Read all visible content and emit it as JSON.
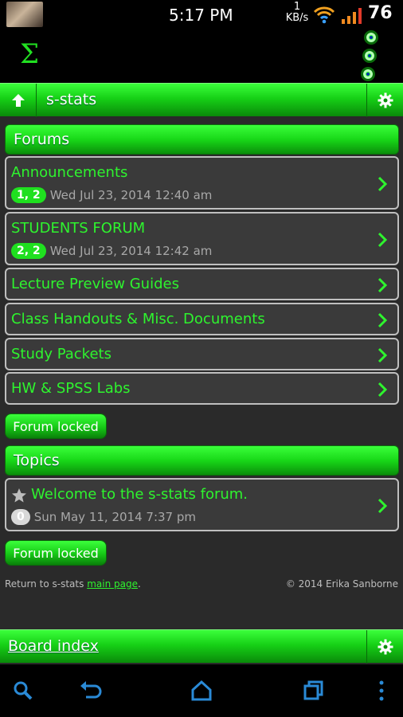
{
  "status_bar": {
    "time": "5:17 PM",
    "net_rate_value": "1",
    "net_rate_unit": "KB/s",
    "battery": "76"
  },
  "app": {
    "logo_symbol": "Σ",
    "accent_color": "#21e021"
  },
  "breadcrumb": {
    "title": "s-stats"
  },
  "forums": {
    "header": "Forums",
    "items": [
      {
        "name": "Announcements",
        "badge": "1, 2",
        "date": "Wed Jul 23, 2014 12:40 am"
      },
      {
        "name": "STUDENTS FORUM",
        "badge": "2, 2",
        "date": "Wed Jul 23, 2014 12:42 am"
      },
      {
        "name": "Lecture Preview Guides"
      },
      {
        "name": "Class Handouts & Misc. Documents"
      },
      {
        "name": "Study Packets"
      },
      {
        "name": "HW & SPSS Labs"
      }
    ],
    "locked_label": "Forum locked"
  },
  "topics": {
    "header": "Topics",
    "items": [
      {
        "name": "Welcome to the s-stats forum.",
        "badge": "0",
        "date": "Sun May 11, 2014 7:37 pm"
      }
    ],
    "locked_label": "Forum locked"
  },
  "footer": {
    "return_prefix": "Return to s-stats",
    "return_link": "main page",
    "return_suffix": ".",
    "copyright": "© 2014 Erika Sanborne"
  },
  "bottom_bar": {
    "title": "Board index"
  }
}
